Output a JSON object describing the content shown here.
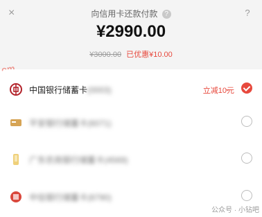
{
  "header": {
    "title": "向信用卡还款付款",
    "help_glyph": "?",
    "amount": "¥2990.00",
    "original_price": "¥3000.00",
    "discount": "已优惠¥10.00",
    "close_glyph": "×",
    "question_glyph": "?"
  },
  "watermark_left": "om",
  "payment_methods": [
    {
      "name": "中国银行储蓄卡",
      "suffix": "(0003)",
      "promo": "立减10元",
      "selected": true,
      "icon": "boc-icon"
    },
    {
      "name": "平安银行储蓄卡",
      "suffix": "(6071)",
      "promo": "",
      "selected": false,
      "icon": "card-icon"
    },
    {
      "name": "广东农商银行储蓄卡",
      "suffix": "(4569)",
      "promo": "",
      "selected": false,
      "icon": "mobile-icon"
    },
    {
      "name": "中信银行储蓄卡",
      "suffix": "(8790)",
      "promo": "",
      "selected": false,
      "icon": "citic-icon"
    }
  ],
  "watermark_bottom": "公众号 · 小钻吧",
  "colors": {
    "accent": "#e7493d"
  }
}
